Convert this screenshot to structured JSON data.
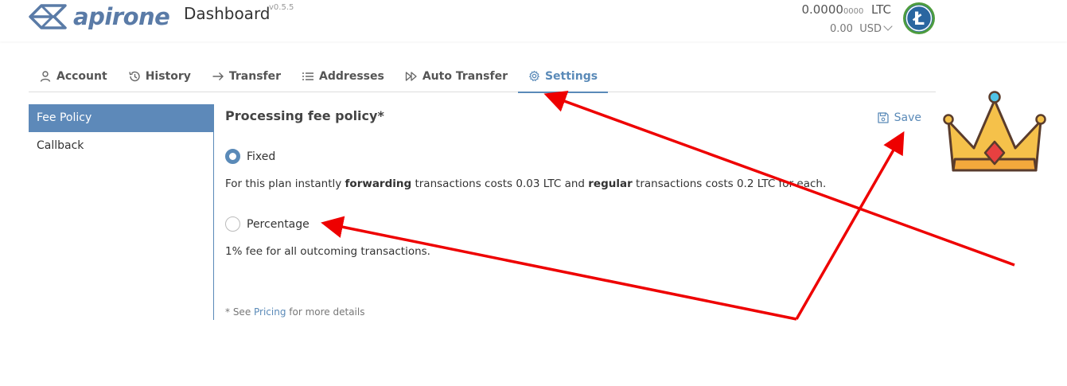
{
  "header": {
    "brand": "apirone",
    "title": "Dashboard",
    "version": "v0.5.5",
    "balance": {
      "ltc_main": "0.0000",
      "ltc_small": "0000",
      "ltc_unit": "LTC",
      "usd_value": "0.00",
      "usd_unit": "USD"
    },
    "coin_icon": "litecoin-icon",
    "coin_letter": "Ł"
  },
  "tabs": [
    {
      "label": "Account",
      "icon": "user-icon"
    },
    {
      "label": "History",
      "icon": "history-icon"
    },
    {
      "label": "Transfer",
      "icon": "arrow-right-icon"
    },
    {
      "label": "Addresses",
      "icon": "list-icon"
    },
    {
      "label": "Auto Transfer",
      "icon": "fast-forward-icon"
    },
    {
      "label": "Settings",
      "icon": "gear-icon",
      "active": true
    }
  ],
  "sidebar": {
    "items": [
      {
        "label": "Fee Policy",
        "active": true
      },
      {
        "label": "Callback"
      }
    ]
  },
  "content": {
    "title": "Processing fee policy*",
    "save_label": "Save",
    "options": [
      {
        "label": "Fixed",
        "checked": true,
        "desc_1": "For this plan instantly ",
        "desc_b1": "forwarding",
        "desc_2": " transactions costs 0.03 LTC and ",
        "desc_b2": "regular",
        "desc_3": " transactions costs 0.2 LTC for each."
      },
      {
        "label": "Percentage",
        "checked": false,
        "desc_1": "1% fee for all outcoming transactions."
      }
    ],
    "footnote_pre": "* See ",
    "footnote_link": "Pricing",
    "footnote_post": " for more details"
  },
  "colors": {
    "accent": "#5a8ab8",
    "brand": "#5a7ba7",
    "annotation": "#ee0000",
    "crown_gold": "#f5c14a",
    "crown_gem": "#e84040"
  }
}
